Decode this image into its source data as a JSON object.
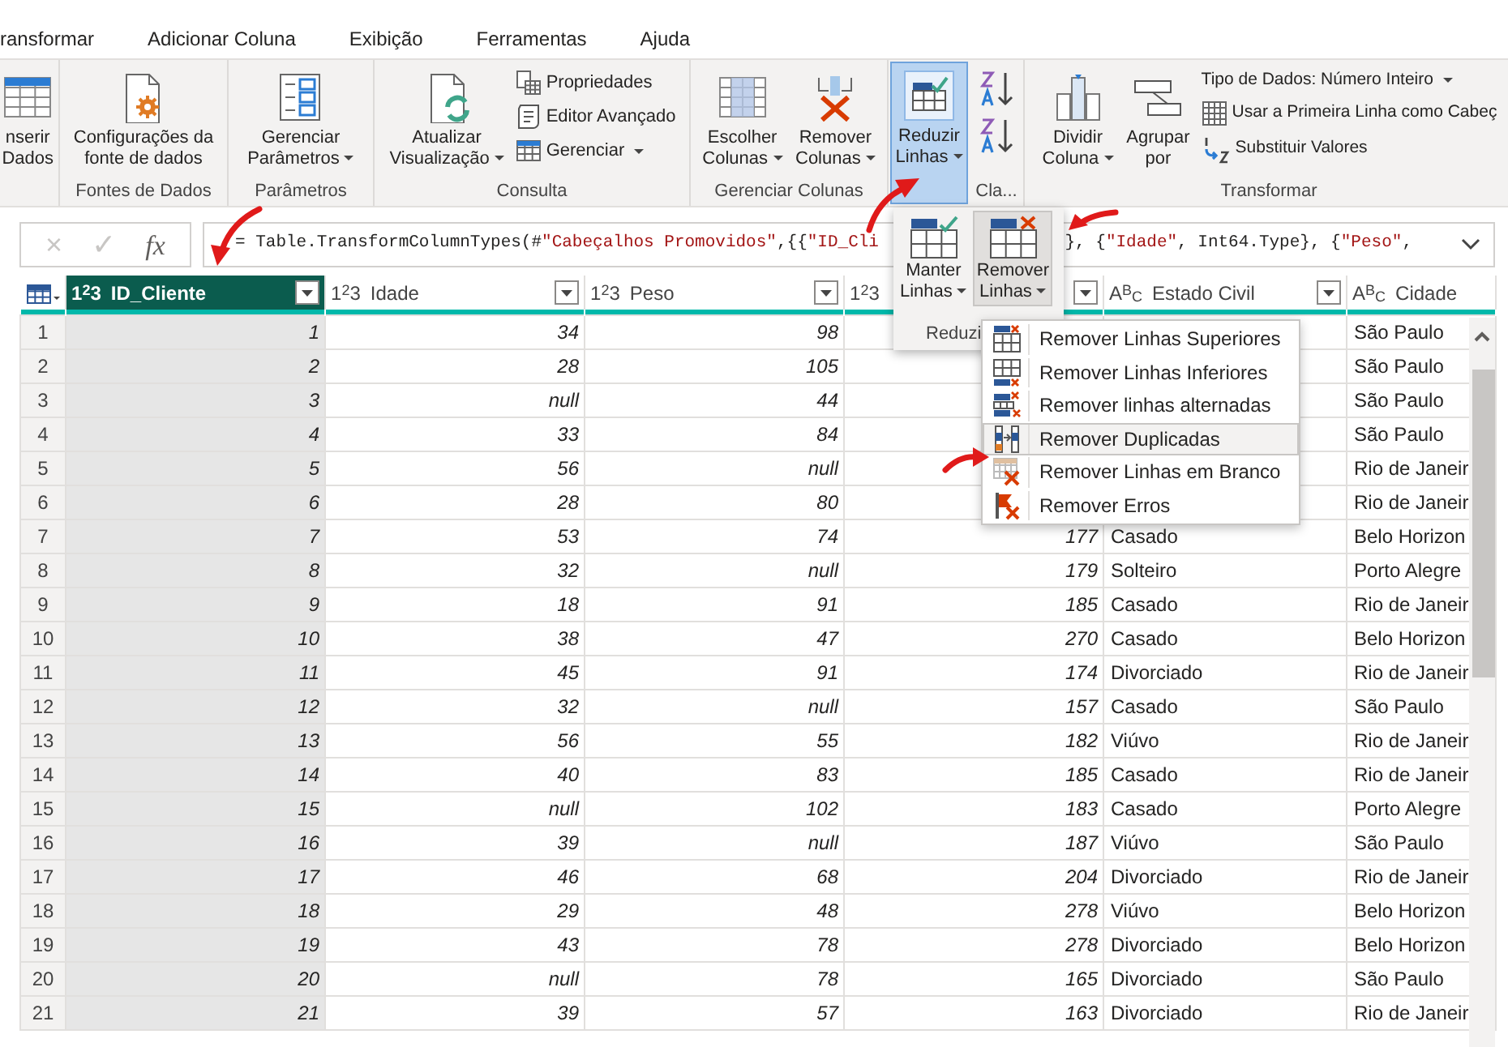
{
  "tabs": [
    {
      "label": "ransformar",
      "selected": false
    },
    {
      "label": "Adicionar Coluna",
      "selected": false
    },
    {
      "label": "Exibição",
      "selected": false
    },
    {
      "label": "Ferramentas",
      "selected": false
    },
    {
      "label": "Ajuda",
      "selected": false
    }
  ],
  "ribbon": {
    "groups": [
      {
        "buttons": [
          {
            "kind": "large",
            "label": "nserir\nDados",
            "dropdown": false,
            "selected": false
          }
        ]
      },
      {
        "label": "Fontes de Dados",
        "buttons": [
          {
            "kind": "large",
            "label": "Configurações da\nfonte de dados",
            "dropdown": false,
            "selected": false
          }
        ]
      },
      {
        "label": "Parâmetros",
        "buttons": [
          {
            "kind": "large",
            "label": "Gerenciar\nParâmetros",
            "dropdown": true,
            "selected": false
          }
        ]
      },
      {
        "label": "Consulta",
        "buttons": [
          {
            "kind": "large",
            "label": "Atualizar\nVisualização",
            "dropdown": true,
            "selected": false
          },
          {
            "kind": "small",
            "label": "Propriedades",
            "dropdown": false,
            "selected": false
          },
          {
            "kind": "small",
            "label": "Editor Avançado",
            "dropdown": false,
            "selected": false
          },
          {
            "kind": "small",
            "label": "Gerenciar",
            "dropdown": true,
            "selected": false
          }
        ]
      },
      {
        "label": "Gerenciar Colunas",
        "buttons": [
          {
            "kind": "large",
            "label": "Escolher\nColunas",
            "dropdown": true,
            "selected": false
          },
          {
            "kind": "large",
            "label": "Remover\nColunas",
            "dropdown": true,
            "selected": false
          }
        ]
      },
      {
        "buttons": [
          {
            "kind": "large",
            "label": "Reduzir\nLinhas",
            "dropdown": true,
            "selected": true
          }
        ]
      },
      {
        "label": "Cla...",
        "buttons": [
          {
            "kind": "icon"
          },
          {
            "kind": "icon"
          }
        ]
      },
      {
        "label": "Transformar",
        "buttons": [
          {
            "kind": "large",
            "label": "Dividir\nColuna",
            "dropdown": true,
            "selected": false
          },
          {
            "kind": "large",
            "label": "Agrupar\npor",
            "dropdown": false,
            "selected": false
          },
          {
            "kind": "small",
            "label": "Tipo de Dados: Número Inteiro",
            "dropdown": true,
            "selected": false
          },
          {
            "kind": "small",
            "label": "Usar a Primeira Linha como Cabeç",
            "dropdown": false,
            "selected": false
          },
          {
            "kind": "small",
            "label": "Substituir Valores",
            "dropdown": false,
            "selected": false
          }
        ]
      }
    ]
  },
  "formula_bar": {
    "buttons": [
      {
        "text": "×",
        "disabled": true
      },
      {
        "text": "✓",
        "disabled": true
      },
      {
        "text": "fx",
        "disabled": false
      }
    ],
    "segments": [
      {
        "tokens": [
          {
            "kind": "code",
            "text": "= Table.TransformColumnTypes(#"
          },
          {
            "kind": "string",
            "text": "\"Cabeçalhos Promovidos\""
          },
          {
            "kind": "code",
            "text": ",{{"
          },
          {
            "kind": "string",
            "text": "\"ID_Cli"
          }
        ]
      },
      {
        "tokens": [
          {
            "kind": "code",
            "text": "}, {"
          },
          {
            "kind": "string",
            "text": "\"Idade\""
          },
          {
            "kind": "code",
            "text": ", Int64.Type}, {"
          },
          {
            "kind": "string",
            "text": "\"Peso\""
          },
          {
            "kind": "code",
            "text": ","
          }
        ]
      }
    ]
  },
  "popup": {
    "group_label": "Reduzi",
    "buttons": [
      {
        "label": "Manter\nLinhas",
        "dropdown": true,
        "selected": false
      },
      {
        "label": "Remover\nLinhas",
        "dropdown": true,
        "selected": true
      }
    ]
  },
  "menu": {
    "items": [
      {
        "label": "Remover Linhas Superiores",
        "highlighted": false
      },
      {
        "label": "Remover Linhas Inferiores",
        "highlighted": false
      },
      {
        "label": "Remover linhas alternadas",
        "highlighted": false
      },
      {
        "label": "Remover Duplicadas",
        "highlighted": true
      },
      {
        "label": "Remover Linhas em Branco",
        "highlighted": false
      },
      {
        "label": "Remover Erros",
        "highlighted": false
      }
    ]
  },
  "table": {
    "columns": [
      {
        "kind": "number",
        "type_icon": "1$^{2}$3",
        "name": "ID_Cliente",
        "selected": true,
        "filter": true
      },
      {
        "kind": "number",
        "type_icon": "1$^{2}$3",
        "name": "Idade",
        "selected": false,
        "filter": true
      },
      {
        "kind": "number",
        "type_icon": "1$^{2}$3",
        "name": "Peso",
        "selected": false,
        "filter": true
      },
      {
        "kind": "number",
        "type_icon": "1$^{2}$3",
        "selected": false,
        "filter": true
      },
      {
        "kind": "text",
        "type_icon": "A$^{B}$$_{C}$",
        "name": "Estado Civil",
        "selected": false,
        "filter": true
      },
      {
        "kind": "text",
        "type_icon": "A$^{B}$$_{C}$",
        "name": "Cidade",
        "selected": false,
        "filter": false
      }
    ],
    "rows": [
      {
        "number": "1",
        "cells": [
          "1",
          "34",
          "98",
          null,
          null,
          "São Paulo"
        ]
      },
      {
        "number": "2",
        "cells": [
          "2",
          "28",
          "105",
          null,
          null,
          "São Paulo"
        ]
      },
      {
        "number": "3",
        "cells": [
          "3",
          "null",
          "44",
          null,
          null,
          "São Paulo"
        ]
      },
      {
        "number": "4",
        "cells": [
          "4",
          "33",
          "84",
          null,
          null,
          "São Paulo"
        ]
      },
      {
        "number": "5",
        "cells": [
          "5",
          "56",
          "null",
          null,
          null,
          "Rio de Janeir"
        ]
      },
      {
        "number": "6",
        "cells": [
          "6",
          "28",
          "80",
          null,
          null,
          "Rio de Janeir"
        ]
      },
      {
        "number": "7",
        "cells": [
          "7",
          "53",
          "74",
          "177",
          "Casado",
          "Belo Horizon"
        ]
      },
      {
        "number": "8",
        "cells": [
          "8",
          "32",
          "null",
          "179",
          "Solteiro",
          "Porto Alegre"
        ]
      },
      {
        "number": "9",
        "cells": [
          "9",
          "18",
          "91",
          "185",
          "Casado",
          "Rio de Janeir"
        ]
      },
      {
        "number": "10",
        "cells": [
          "10",
          "38",
          "47",
          "270",
          "Casado",
          "Belo Horizon"
        ]
      },
      {
        "number": "11",
        "cells": [
          "11",
          "45",
          "91",
          "174",
          "Divorciado",
          "Rio de Janeir"
        ]
      },
      {
        "number": "12",
        "cells": [
          "12",
          "32",
          "null",
          "157",
          "Casado",
          "São Paulo"
        ]
      },
      {
        "number": "13",
        "cells": [
          "13",
          "56",
          "55",
          "182",
          "Viúvo",
          "Rio de Janeir"
        ]
      },
      {
        "number": "14",
        "cells": [
          "14",
          "40",
          "83",
          "185",
          "Casado",
          "Rio de Janeir"
        ]
      },
      {
        "number": "15",
        "cells": [
          "15",
          "null",
          "102",
          "183",
          "Casado",
          "Porto Alegre"
        ]
      },
      {
        "number": "16",
        "cells": [
          "16",
          "39",
          "null",
          "187",
          "Viúvo",
          "São Paulo"
        ]
      },
      {
        "number": "17",
        "cells": [
          "17",
          "46",
          "68",
          "204",
          "Divorciado",
          "Rio de Janeir"
        ]
      },
      {
        "number": "18",
        "cells": [
          "18",
          "29",
          "48",
          "278",
          "Viúvo",
          "Belo Horizon"
        ]
      },
      {
        "number": "19",
        "cells": [
          "19",
          "43",
          "78",
          "278",
          "Divorciado",
          "Belo Horizon"
        ]
      },
      {
        "number": "20",
        "cells": [
          "20",
          "null",
          "78",
          "165",
          "Divorciado",
          "São Paulo"
        ]
      },
      {
        "number": "21",
        "cells": [
          "21",
          "39",
          "57",
          "163",
          "Divorciado",
          "Rio de Janeir"
        ]
      }
    ]
  }
}
